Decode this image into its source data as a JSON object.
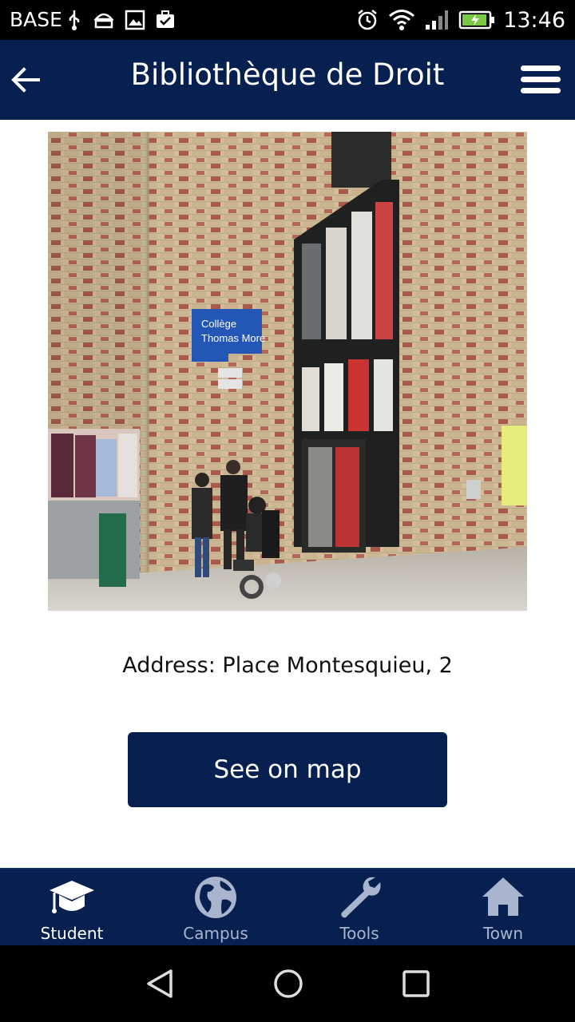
{
  "status_bar": {
    "carrier": "BASE",
    "time": "13:46",
    "icons": [
      "usb-icon",
      "android-icon",
      "image-icon",
      "briefcase-check-icon",
      "alarm-icon",
      "wifi-icon",
      "signal-icon",
      "battery-charging-icon"
    ]
  },
  "app_bar": {
    "title": "Bibliothèque de Droit",
    "back_icon": "arrow-left-icon",
    "menu_icon": "hamburger-menu-icon"
  },
  "photo": {
    "sign_line1": "Collège",
    "sign_line2": "Thomas More"
  },
  "address": "Address: Place Montesquieu, 2",
  "map_button": "See on map",
  "bottom_nav": {
    "items": [
      {
        "label": "Student",
        "icon": "graduation-cap-icon",
        "active": true
      },
      {
        "label": "Campus",
        "icon": "globe-icon",
        "active": false
      },
      {
        "label": "Tools",
        "icon": "wrench-icon",
        "active": false
      },
      {
        "label": "Town",
        "icon": "home-icon",
        "active": false
      }
    ]
  },
  "system_nav": [
    "back-triangle-icon",
    "home-circle-icon",
    "recents-square-icon"
  ],
  "colors": {
    "primary": "#07204f",
    "inactive_nav": "#a9b4cf",
    "brick": "#cdb896"
  }
}
